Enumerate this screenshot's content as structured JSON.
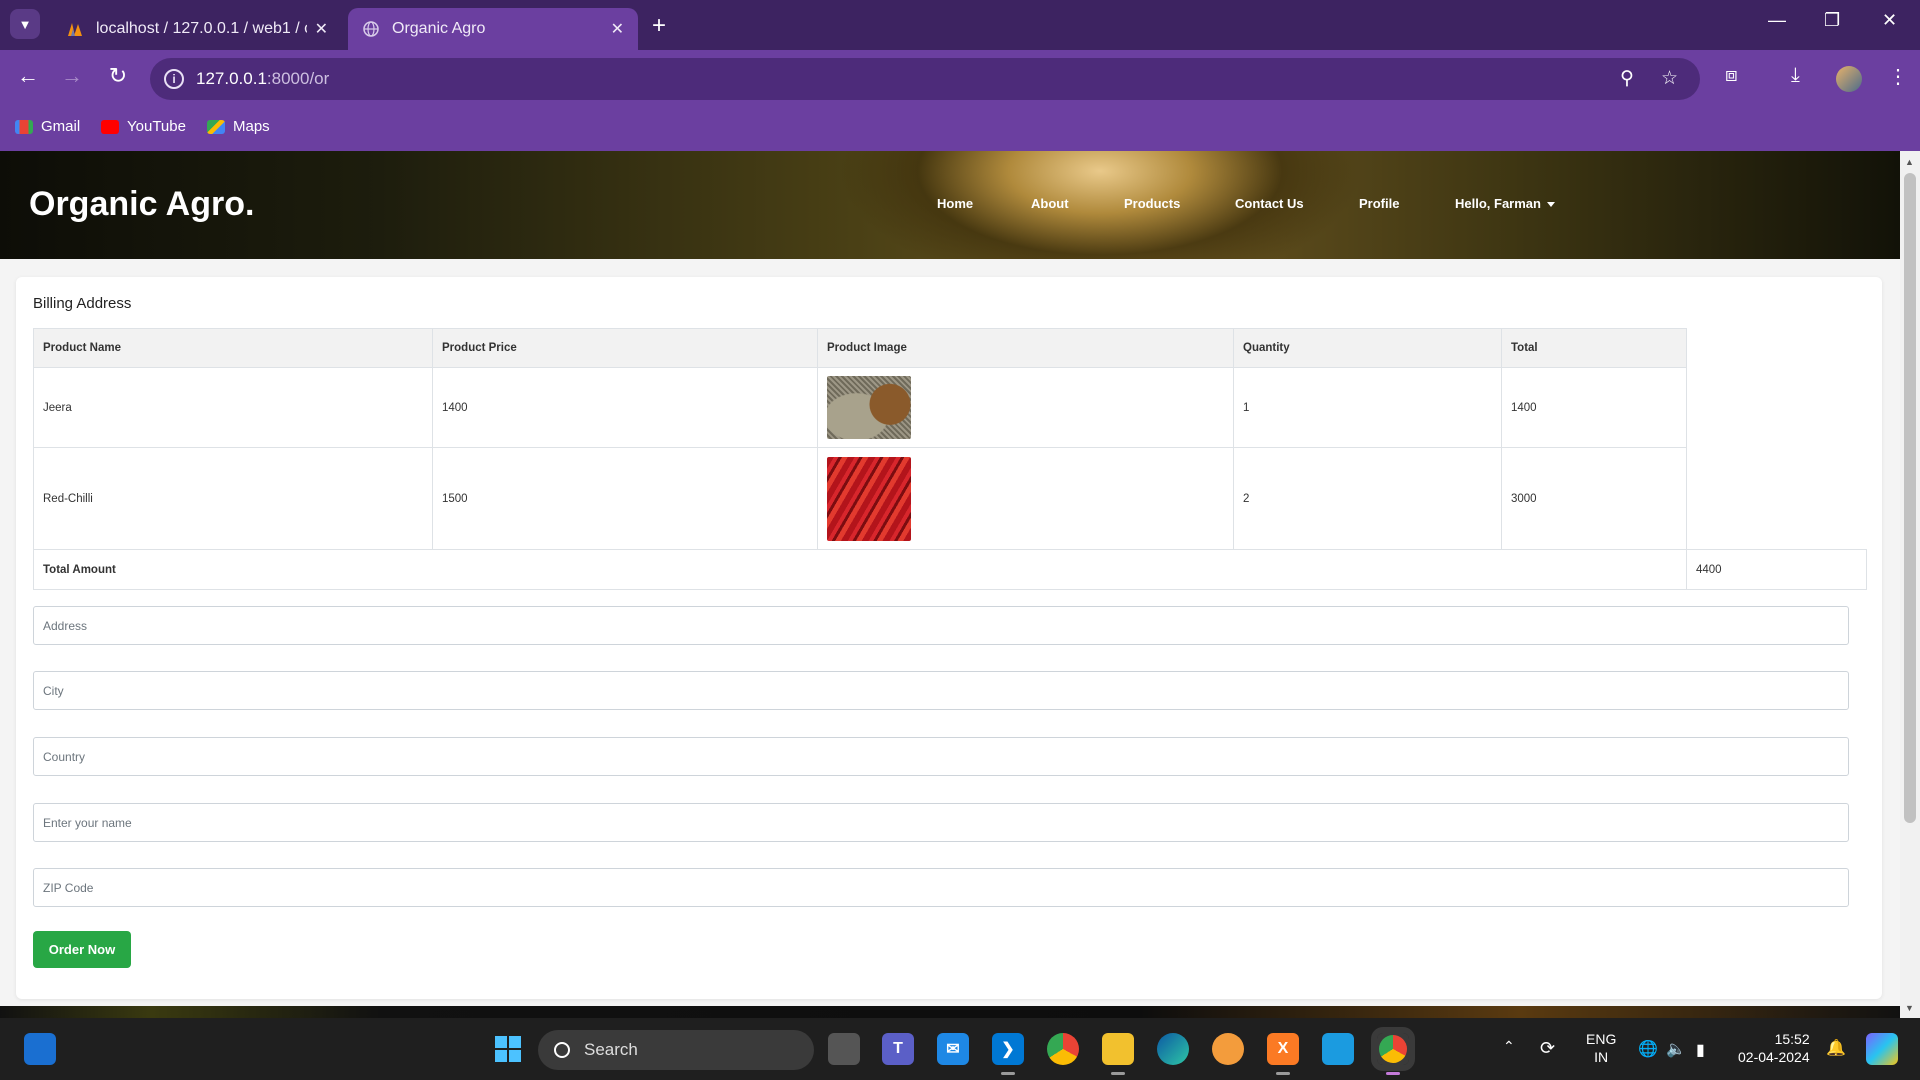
{
  "browser": {
    "tabs": [
      {
        "title": "localhost / 127.0.0.1 / web1 / or",
        "active": false
      },
      {
        "title": "Organic Agro",
        "active": true
      }
    ],
    "url_host": "127.0.0.1",
    "url_rest": ":8000/or",
    "bookmarks": [
      {
        "label": "Gmail"
      },
      {
        "label": "YouTube"
      },
      {
        "label": "Maps"
      }
    ]
  },
  "site": {
    "brand": "Organic Agro.",
    "nav": [
      "Home",
      "About",
      "Products",
      "Contact Us",
      "Profile"
    ],
    "user_menu": "Hello, Farman"
  },
  "billing": {
    "title": "Billing Address",
    "columns": [
      "Product Name",
      "Product Price",
      "Product Image",
      "Quantity",
      "Total"
    ],
    "rows": [
      {
        "name": "Jeera",
        "price": "1400",
        "image": "cumin-seeds-image",
        "quantity": "1",
        "total": "1400"
      },
      {
        "name": "Red-Chilli",
        "price": "1500",
        "image": "red-chilli-image",
        "quantity": "2",
        "total": "3000"
      }
    ],
    "total_label": "Total Amount",
    "total_value": "4400",
    "fields": {
      "address": "Address",
      "city": "City",
      "country": "Country",
      "name": "Enter your name",
      "zip": "ZIP Code"
    },
    "submit_label": "Order Now"
  },
  "taskbar": {
    "search_placeholder": "Search",
    "language": "ENG",
    "region": "IN",
    "time": "15:52",
    "date": "02-04-2024"
  },
  "colors": {
    "browser_frame": "#6b3fa0",
    "tabstrip": "#3d2361",
    "order_button": "#28a745"
  }
}
